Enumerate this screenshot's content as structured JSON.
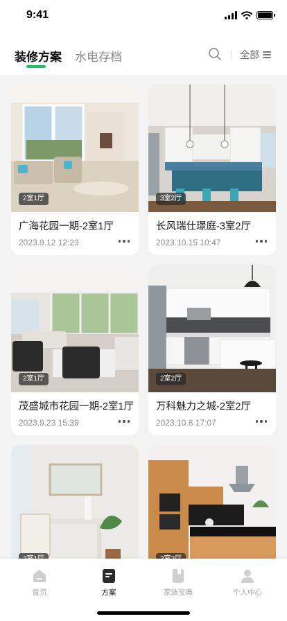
{
  "status_bar": {
    "time": "9:41"
  },
  "header": {
    "tabs": [
      {
        "label": "装修方案",
        "active": true
      },
      {
        "label": "水电存档",
        "active": false
      }
    ],
    "filter_label": "全部",
    "accent_color": "#1fbf6b"
  },
  "cards": [
    {
      "tag": "2室1厅",
      "title": "广海花园一期-2室1厅",
      "time": "2023.9.12 12:23"
    },
    {
      "tag": "3室2厅",
      "title": "长风瑞仕璟庭-3室2厅",
      "time": "2023.10.15 10:47"
    },
    {
      "tag": "2室1厅",
      "title": "茂盛城市花园一期-2室1厅",
      "time": "2023.9.23 15:39"
    },
    {
      "tag": "2室2厅",
      "title": "万科魅力之城-2室2厅",
      "time": "2023.10.8 17:07"
    },
    {
      "tag": "2室1厅",
      "title": "",
      "time": ""
    },
    {
      "tag": "2室2厅",
      "title": "",
      "time": ""
    }
  ],
  "tabbar": {
    "items": [
      {
        "label": "首页",
        "icon": "home-icon",
        "active": false
      },
      {
        "label": "方案",
        "icon": "plan-icon",
        "active": true
      },
      {
        "label": "家装宝典",
        "icon": "book-icon",
        "active": false
      },
      {
        "label": "个人中心",
        "icon": "user-icon",
        "active": false
      }
    ]
  }
}
